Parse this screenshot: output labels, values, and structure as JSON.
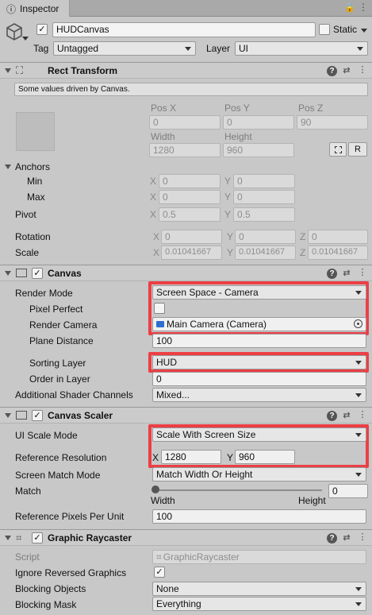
{
  "tab": {
    "title": "Inspector"
  },
  "object": {
    "name": "HUDCanvas",
    "static_label": "Static",
    "tag_label": "Tag",
    "tag_value": "Untagged",
    "layer_label": "Layer",
    "layer_value": "UI"
  },
  "rect": {
    "title": "Rect Transform",
    "info": "Some values driven by Canvas.",
    "pos_x_label": "Pos X",
    "pos_y_label": "Pos Y",
    "pos_z_label": "Pos Z",
    "pos_x": "0",
    "pos_y": "0",
    "pos_z": "90",
    "width_label": "Width",
    "height_label": "Height",
    "width": "1280",
    "height": "960",
    "r_button": "R",
    "anchors_label": "Anchors",
    "min_label": "Min",
    "max_label": "Max",
    "min_x": "0",
    "min_y": "0",
    "max_x": "0",
    "max_y": "0",
    "pivot_label": "Pivot",
    "pivot_x": "0.5",
    "pivot_y": "0.5",
    "rotation_label": "Rotation",
    "rot_x": "0",
    "rot_y": "0",
    "rot_z": "0",
    "scale_label": "Scale",
    "scale_x": "0.01041667",
    "scale_y": "0.01041667",
    "scale_z": "0.01041667",
    "axis_x": "X",
    "axis_y": "Y",
    "axis_z": "Z"
  },
  "canvas": {
    "title": "Canvas",
    "render_mode_label": "Render Mode",
    "render_mode": "Screen Space - Camera",
    "pixel_perfect_label": "Pixel Perfect",
    "render_camera_label": "Render Camera",
    "render_camera": "Main Camera (Camera)",
    "plane_distance_label": "Plane Distance",
    "plane_distance": "100",
    "sorting_layer_label": "Sorting Layer",
    "sorting_layer": "HUD",
    "order_label": "Order in Layer",
    "order": "0",
    "shader_channels_label": "Additional Shader Channels",
    "shader_channels": "Mixed..."
  },
  "scaler": {
    "title": "Canvas Scaler",
    "ui_scale_label": "UI Scale Mode",
    "ui_scale": "Scale With Screen Size",
    "ref_res_label": "Reference Resolution",
    "ref_x": "1280",
    "ref_y": "960",
    "match_mode_label": "Screen Match Mode",
    "match_mode": "Match Width Or Height",
    "match_label": "Match",
    "match_value": "0",
    "match_fraction": 0,
    "width_hint": "Width",
    "height_hint": "Height",
    "ppu_label": "Reference Pixels Per Unit",
    "ppu": "100"
  },
  "raycaster": {
    "title": "Graphic Raycaster",
    "script_label": "Script",
    "script": "GraphicRaycaster",
    "ignore_label": "Ignore Reversed Graphics",
    "blocking_objects_label": "Blocking Objects",
    "blocking_objects": "None",
    "blocking_mask_label": "Blocking Mask",
    "blocking_mask": "Everything"
  },
  "colors": {
    "highlight": "#ec3f45"
  }
}
